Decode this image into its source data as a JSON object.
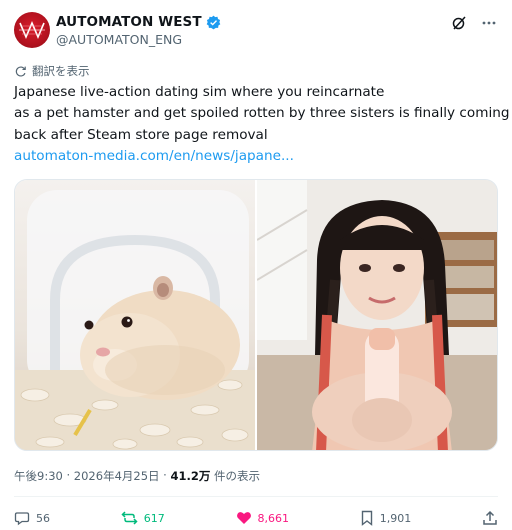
{
  "account": {
    "display_name": "AUTOMATON WEST",
    "handle": "@AUTOMATON_ENG",
    "verified_color": "#1d9bf0"
  },
  "header_icons": [
    "grok-icon",
    "more-icon"
  ],
  "translate_label": "翻訳を表示",
  "tweet": {
    "lines": [
      "Japanese live-action dating sim where you reincarnate",
      "as a pet hamster and get spoiled rotten by three sisters is finally coming",
      "back after Steam store page removal"
    ],
    "link": "automaton-media.com/en/news/japane..."
  },
  "meta": {
    "time": "午後9:30",
    "date": "2026年4月25日",
    "views": "41.2万",
    "views_suffix": "件の表示"
  },
  "actions": {
    "replies": "56",
    "reposts": "617",
    "likes": "8,661",
    "bookmarks": "1,901"
  },
  "colors": {
    "text": "#0f1419",
    "muted": "#536471",
    "link": "#1d9bf0",
    "repost": "#00ba7c",
    "like": "#f91880"
  }
}
